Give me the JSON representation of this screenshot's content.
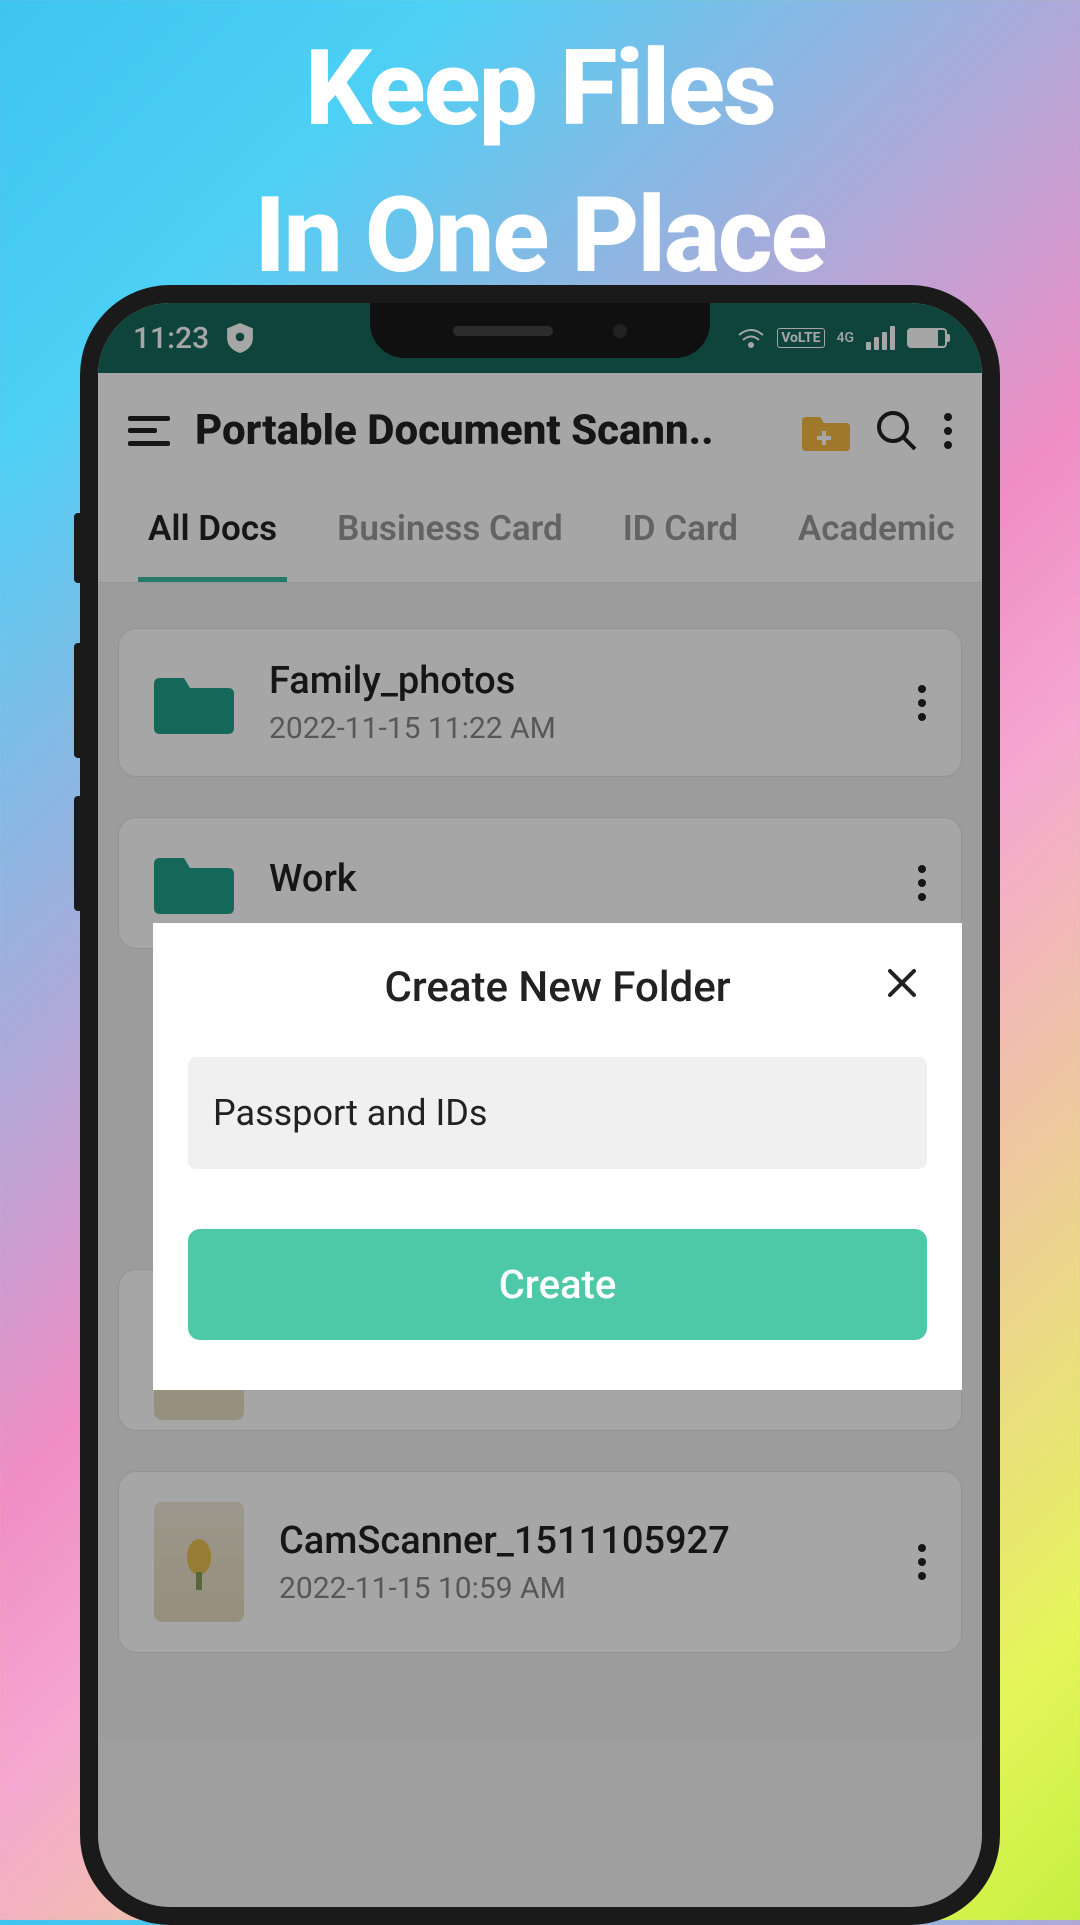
{
  "promo": {
    "line1": "Keep Files",
    "line2": "In One Place"
  },
  "status": {
    "time": "11:23",
    "network": "4G",
    "volte": "VoLTE"
  },
  "header": {
    "title": "Portable Document Scann.."
  },
  "tabs": [
    {
      "label": "All Docs",
      "active": true
    },
    {
      "label": "Business Card",
      "active": false
    },
    {
      "label": "ID Card",
      "active": false
    },
    {
      "label": "Academic",
      "active": false
    }
  ],
  "folders": [
    {
      "name": "Family_photos",
      "date": "2022-11-15  11:22 AM"
    },
    {
      "name": "Work",
      "date": ""
    }
  ],
  "docs": [
    {
      "name": "CamScanner_1511105927",
      "date": "2022-11-15  10:59 AM"
    }
  ],
  "dialog": {
    "title": "Create New Folder",
    "input_value": "Passport and IDs",
    "create_label": "Create"
  }
}
